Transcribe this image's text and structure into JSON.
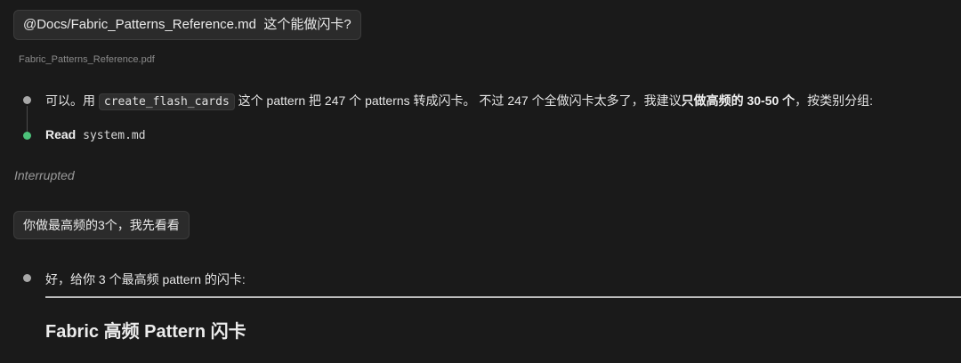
{
  "messages": {
    "user1": {
      "mention": "@Docs/Fabric_Patterns_Reference.md",
      "text": "这个能做闪卡?",
      "attachment": "Fabric_Patterns_Reference.pdf"
    },
    "assistant1": {
      "prefix": "可以。用",
      "code": "create_flash_cards",
      "middle": "这个 pattern 把 247 个 patterns 转成闪卡。 不过 247 个全做闪卡太多了，我建议",
      "bold": "只做高频的 30-50 个",
      "suffix": "，按类别分组:"
    },
    "tool_call": {
      "name": "Read",
      "arg": "system.md"
    },
    "status": "Interrupted",
    "user2": {
      "text": "你做最高频的3个，我先看看"
    },
    "assistant2": {
      "text": "好，给你 3 个最高频 pattern 的闪卡:",
      "heading": "Fabric 高频 Pattern 闪卡"
    }
  },
  "colors": {
    "background": "#1a1a1a",
    "bubble": "#2b2b2b",
    "bullet_default": "#a8a8a8",
    "bullet_tool": "#4cc27a"
  }
}
